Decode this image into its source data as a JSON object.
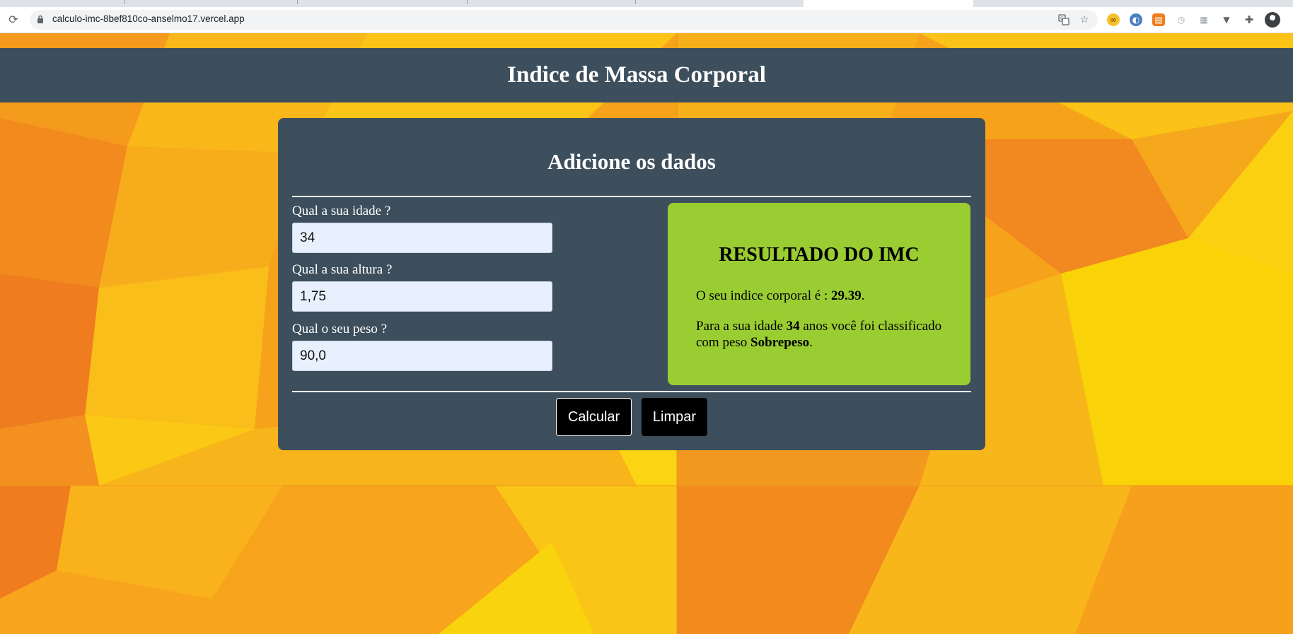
{
  "browser": {
    "url": "calculo-imc-8bef810co-anselmo17.vercel.app",
    "icons": [
      "reload-icon",
      "lock-icon",
      "translate-icon",
      "star-icon",
      "puzzle-icon",
      "profile-icon"
    ]
  },
  "header": {
    "title": "Indice de Massa Corporal"
  },
  "form": {
    "title": "Adicione os dados",
    "age_label": "Qual a sua idade ?",
    "age_value": "34",
    "height_label": "Qual a sua altura ?",
    "height_value": "1,75",
    "weight_label": "Qual o seu peso ?",
    "weight_value": "90,0"
  },
  "result": {
    "title": "RESULTADO DO IMC",
    "index_prefix": "O seu indice corporal é : ",
    "index_value": "29.39",
    "index_suffix": ".",
    "age_prefix": "Para a sua idade ",
    "age_value": "34",
    "age_middle": " anos você foi classificado com peso ",
    "classification": "Sobrepeso",
    "classification_suffix": "."
  },
  "buttons": {
    "calculate": "Calcular",
    "clear": "Limpar"
  },
  "colors": {
    "panel": "#3d4f5d",
    "result_bg": "#9acd32",
    "background_orange": "#f7a21b",
    "background_yellow": "#f9d308"
  }
}
